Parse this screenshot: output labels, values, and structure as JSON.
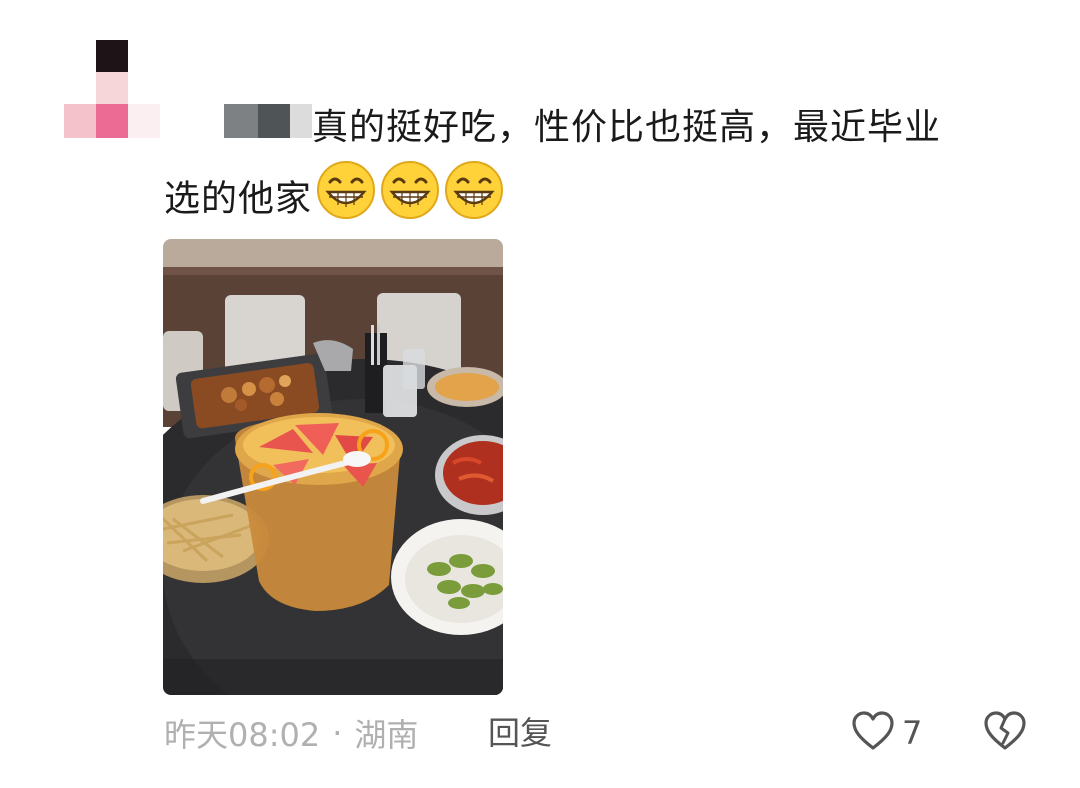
{
  "comment": {
    "author_avatar": "censored-avatar",
    "author_name": "",
    "text_line1": "真的挺好吃，性价比也挺高，最近毕业",
    "text_line2": "选的他家",
    "emojis": [
      "grin-emoji",
      "grin-emoji",
      "grin-emoji"
    ],
    "image": "restaurant-table-photo",
    "timestamp": "昨天08:02",
    "separator": "·",
    "location": "湖南",
    "reply_label": "回复",
    "like_count": "7"
  },
  "icons": {
    "like": "heart-outline-icon",
    "dislike": "broken-heart-icon"
  },
  "colors": {
    "text": "#1a1a1a",
    "meta": "#b0b0b0",
    "action": "#555555",
    "emoji": "#ffd23a"
  }
}
